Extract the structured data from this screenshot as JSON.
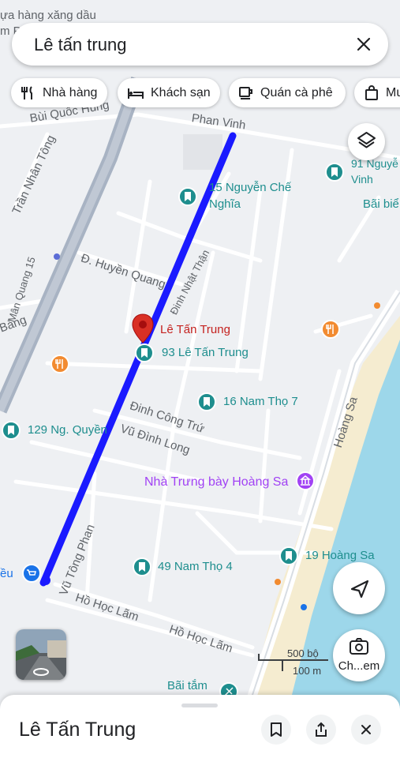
{
  "search": {
    "query": "Lê tấn trung"
  },
  "chips": [
    {
      "label": "Nhà hàng",
      "icon": "fork-knife-icon"
    },
    {
      "label": "Khách sạn",
      "icon": "bed-icon"
    },
    {
      "label": "Quán cà phê",
      "icon": "coffee-cup-icon"
    },
    {
      "label": "Mu",
      "icon": "shopping-bag-icon"
    }
  ],
  "map": {
    "top_cut_label": "ựa hàng xăng dầu",
    "top_cut_label2": "m P",
    "streets": {
      "bui_quoc_hung": "Bùi Quốc Hùng",
      "phan_vinh": "Phan Vinh",
      "tran_nhan_tong": "Trần Nhân Tông",
      "huyen_quang": "Đ. Huyền Quang",
      "man_quang": "Mân Quang 15",
      "bang": "Bàng",
      "dinh_nhat_than": "Đinh Nhật Thận",
      "dinh_cong_tru": "Đinh Công Trứ",
      "vu_dinh_long": "Vũ Đình Long",
      "vu_tong_phan": "Vũ Tông Phan",
      "ho_hoc_lam_1": "Hồ Học Lãm",
      "ho_hoc_lam_2": "Hồ Học Lãm",
      "hoang_sa": "Hoàng Sa"
    },
    "places": {
      "nguyen_che_nghia": "15 Nguyễn Chế Nghĩa",
      "nguyen_che_nghia_l1": "15 Nguyễn Chế",
      "nguyen_che_nghia_l2": "Nghĩa",
      "nguyen_vinh_l1": "91 Nguyễ",
      "nguyen_vinh_l2": "Vinh",
      "bai_bien": "Bãi biể",
      "le_tan_trung": "Lê Tấn Trung",
      "le_tan_trung_93": "93 Lê Tấn Trung",
      "nam_tho_16": "16 Nam Thọ 7",
      "ng_quyen_129": "129 Ng. Quyền",
      "nha_trung_bay": "Nhà Trưng bày Hoàng Sa",
      "hoang_sa_19": "19 Hoàng Sa",
      "nam_tho_49": "49 Nam Thọ 4",
      "eu": "ều",
      "bai_tam": "Bãi tắm"
    },
    "scale": {
      "top": "500 bộ",
      "bottom": "100 m"
    },
    "colors": {
      "route": "#1a1aff",
      "pin": "#d93025",
      "water": "#9dd7ea",
      "sand": "#f5ecd0"
    }
  },
  "buttons": {
    "layers": "layers-icon",
    "locate": "navigate-icon",
    "lens_label": "Ch...em"
  },
  "sheet": {
    "title": "Lê Tấn Trung"
  }
}
